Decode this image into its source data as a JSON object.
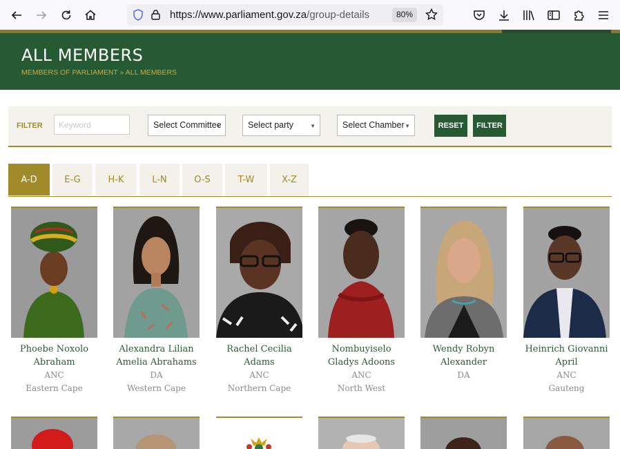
{
  "browser": {
    "url_host": "https://www.parliament.gov.za",
    "url_path": "/group-details",
    "zoom": "80%"
  },
  "header": {
    "title": "ALL MEMBERS",
    "breadcrumb": "MEMBERS OF PARLIAMENT » ALL MEMBERS"
  },
  "filter": {
    "label": "FILTER",
    "keyword_placeholder": "Keyword",
    "committee": "Select Committee",
    "party": "Select party",
    "chamber": "Select Chamber",
    "reset_label": "RESET",
    "filter_label": "FILTER"
  },
  "tabs": [
    "A-D",
    "E-G",
    "H-K",
    "L-N",
    "O-S",
    "T-W",
    "X-Z"
  ],
  "active_tab": "A-D",
  "members": [
    {
      "name": "Phoebe Noxolo Abraham",
      "party": "ANC",
      "province": "Eastern Cape"
    },
    {
      "name": "Alexandra Lilian Amelia Abrahams",
      "party": "DA",
      "province": "Western Cape"
    },
    {
      "name": "Rachel Cecilia Adams",
      "party": "ANC",
      "province": "Northern Cape"
    },
    {
      "name": "Nombuyiselo Gladys Adoons",
      "party": "ANC",
      "province": "North West"
    },
    {
      "name": "Wendy Robyn Alexander",
      "party": "DA",
      "province": ""
    },
    {
      "name": "Heinrich Giovanni April",
      "party": "ANC",
      "province": "Gauteng"
    }
  ],
  "colors": {
    "brand_green": "#265a33",
    "gold": "#a08a2a"
  }
}
